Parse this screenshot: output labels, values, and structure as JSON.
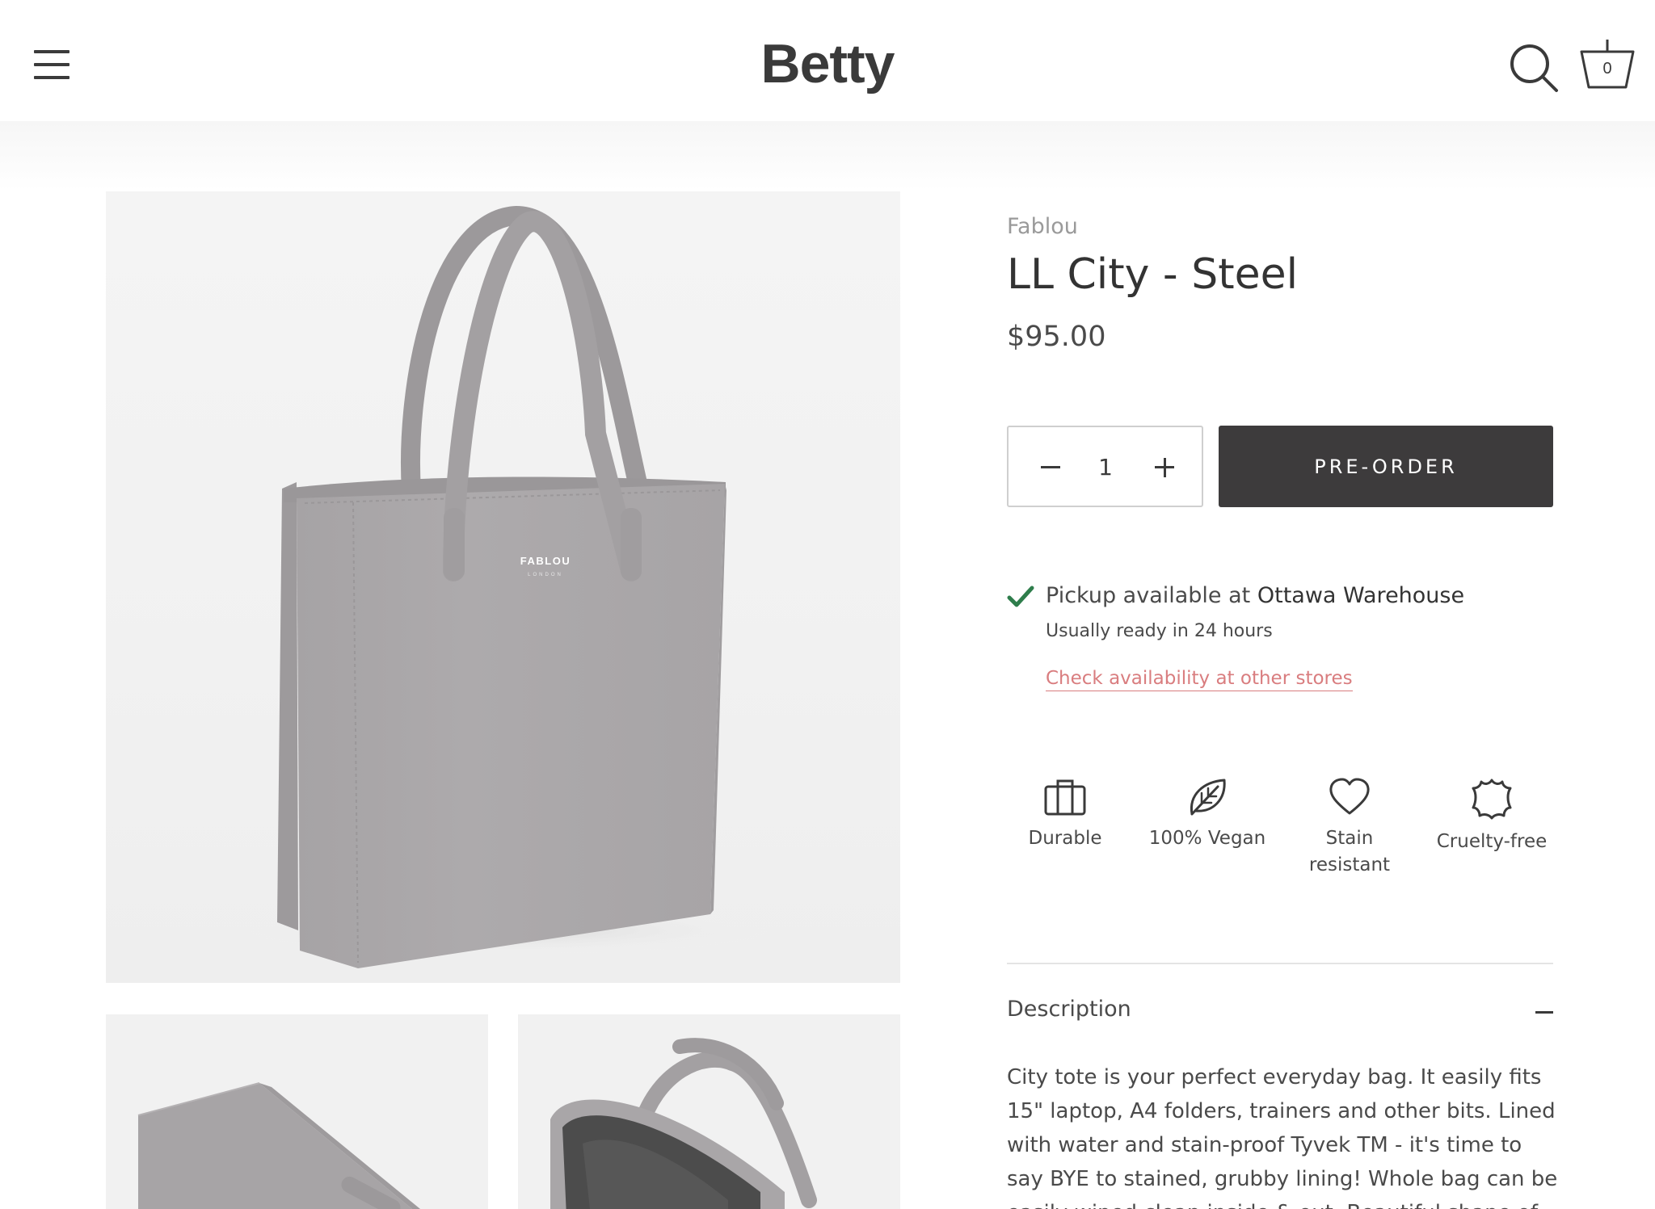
{
  "header": {
    "logo": "Betty",
    "cart_count": "0"
  },
  "gallery": {
    "main_image_brand": "FABLOU",
    "main_image_subbrand": "LONDON"
  },
  "product": {
    "vendor": "Fablou",
    "title": "LL City - Steel",
    "price": "$95.00",
    "quantity": "1",
    "preorder_label": "PRE-ORDER"
  },
  "pickup": {
    "text": "Pickup available at",
    "location": "Ottawa Warehouse",
    "subtext": "Usually ready in 24 hours",
    "link": "Check availability at other stores"
  },
  "features": [
    {
      "label": "Durable",
      "icon": "briefcase-icon"
    },
    {
      "label": "100% Vegan",
      "icon": "leaf-icon"
    },
    {
      "label": "Stain resistant",
      "icon": "heart-icon"
    },
    {
      "label": "Cruelty-free",
      "icon": "leather-hide-icon"
    }
  ],
  "description": {
    "title": "Description",
    "body": "City tote is your perfect everyday bag. It easily fits 15\" laptop, A4 folders, trainers and other bits. Lined with water and stain-proof Tyvek TM - it's time to say BYE to stained, grubby lining! Whole bag can be easily wiped clean inside & out. Beautiful shape of"
  },
  "colors": {
    "button_dark": "#3d3b3c",
    "link_pink": "#d97d7f",
    "check_green": "#2e7d4b",
    "bag_grey": "#a9a6a8"
  }
}
